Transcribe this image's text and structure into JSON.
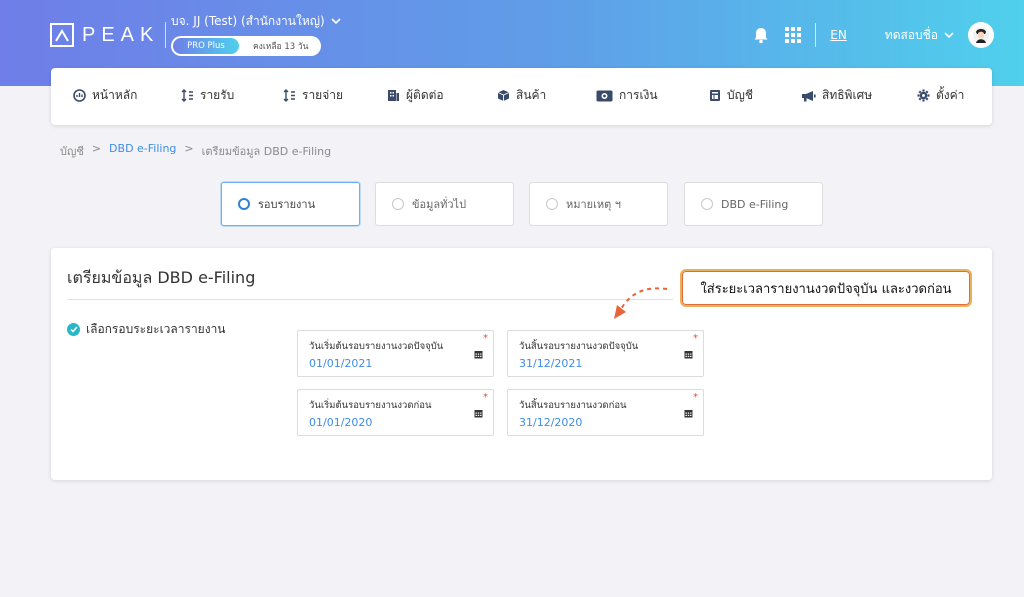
{
  "header": {
    "logo_text": "PEAK",
    "company_name": "บจ. JJ (Test) (สำนักงานใหญ่)",
    "plan_name": "PRO Plus",
    "plan_days": "คงเหลือ 13 วัน",
    "language": "EN",
    "user_name": "ทดสอบชื่อ"
  },
  "nav": {
    "items": [
      {
        "label": "หน้าหลัก",
        "icon": "dashboard-icon"
      },
      {
        "label": "รายรับ",
        "icon": "income-icon"
      },
      {
        "label": "รายจ่าย",
        "icon": "expense-icon"
      },
      {
        "label": "ผู้ติดต่อ",
        "icon": "contacts-icon"
      },
      {
        "label": "สินค้า",
        "icon": "product-icon"
      },
      {
        "label": "การเงิน",
        "icon": "money-icon"
      },
      {
        "label": "บัญชี",
        "icon": "accounting-icon"
      },
      {
        "label": "สิทธิพิเศษ",
        "icon": "megaphone-icon"
      },
      {
        "label": "ตั้งค่า",
        "icon": "gear-icon"
      }
    ]
  },
  "breadcrumb": {
    "items": [
      "บัญชี",
      "DBD e-Filing",
      "เตรียมข้อมูล DBD e-Filing"
    ],
    "separator": ">"
  },
  "steps": [
    {
      "label": "รอบรายงาน",
      "active": true
    },
    {
      "label": "ข้อมูลทั่วไป",
      "active": false
    },
    {
      "label": "หมายเหตุ ฯ",
      "active": false
    },
    {
      "label": "DBD e-Filing",
      "active": false
    }
  ],
  "card": {
    "title": "เตรียมข้อมูล DBD e-Filing",
    "section_label": "เลือกรอบระยะเวลารายงาน",
    "fields": [
      {
        "label": "วันเริ่มต้นรอบรายงานงวดปัจจุบัน",
        "value": "01/01/2021"
      },
      {
        "label": "วันสิ้นรอบรายงานงวดปัจจุบัน",
        "value": "31/12/2021"
      },
      {
        "label": "วันเริ่มต้นรอบรายงานงวดก่อน",
        "value": "01/01/2020"
      },
      {
        "label": "วันสิ้นรอบรายงานงวดก่อน",
        "value": "31/12/2020"
      }
    ],
    "required_mark": "*"
  },
  "callout": {
    "text": "ใส่ระยะเวลารายงานงวดปัจจุบัน และงวดก่อน"
  },
  "colors": {
    "accent_blue": "#3f8ce8",
    "check_teal": "#29b6c6",
    "callout_border": "#e26b3c",
    "arrow": "#e8643a"
  }
}
